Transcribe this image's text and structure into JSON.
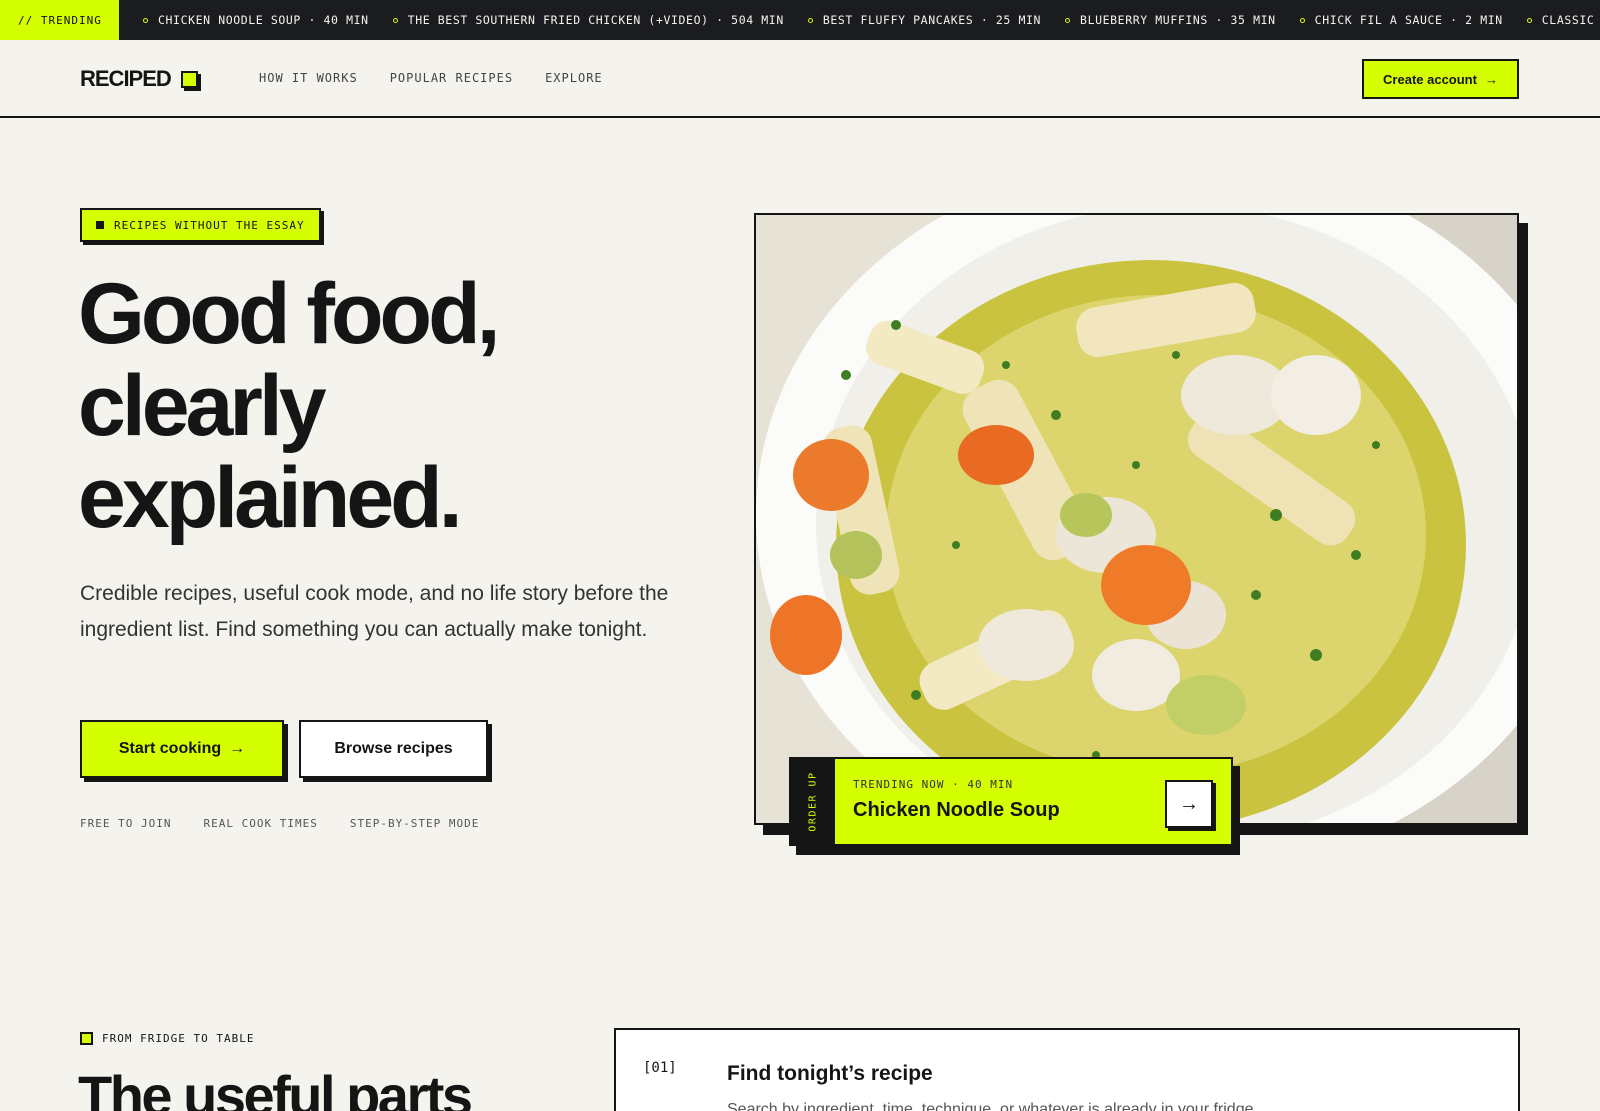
{
  "ticker": {
    "label": "// TRENDING",
    "items": [
      "CHICKEN NOODLE SOUP · 40 MIN",
      "THE BEST SOUTHERN FRIED CHICKEN (+VIDEO) · 504 MIN",
      "BEST FLUFFY PANCAKES · 25 MIN",
      "BLUEBERRY MUFFINS · 35 MIN",
      "CHICK FIL A SAUCE · 2 MIN",
      "CLASSIC"
    ]
  },
  "header": {
    "logo": "RECIPED",
    "nav": [
      "HOW IT WORKS",
      "POPULAR RECIPES",
      "EXPLORE"
    ],
    "cta": "Create account"
  },
  "hero": {
    "badge": "RECIPES WITHOUT THE ESSAY",
    "title_lines": [
      "Good food,",
      "clearly",
      "explained."
    ],
    "subtitle": "Credible recipes, useful cook mode, and no life story before the ingredient list. Find something you can actually make tonight.",
    "primary_button": "Start cooking",
    "secondary_button": "Browse recipes",
    "features": [
      "FREE TO JOIN",
      "REAL COOK TIMES",
      "STEP-BY-STEP MODE"
    ]
  },
  "trending_card": {
    "side_label": "ORDER UP",
    "meta": "TRENDING NOW · 40 MIN",
    "title": "Chicken Noodle Soup"
  },
  "section": {
    "label": "FROM FRIDGE TO TABLE",
    "title": "The useful parts",
    "step_number": "[01]",
    "step_title": "Find tonight’s recipe",
    "step_desc": "Search by ingredient, time, technique, or whatever is already in your fridge."
  },
  "icons": {
    "arrow": "arrow-right-icon"
  },
  "colors": {
    "accent": "#d4ff00",
    "ink": "#151515",
    "background": "#f5f3ee"
  }
}
